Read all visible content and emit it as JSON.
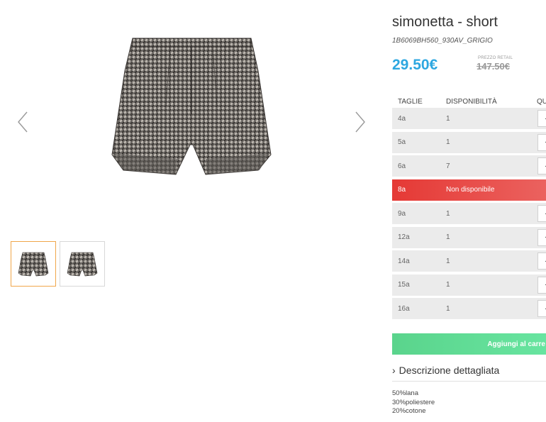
{
  "product": {
    "title": "simonetta - short",
    "sku": "1B6069BH560_930AV_GRIGIO",
    "price": "29.50€",
    "retail_label": "PREZZO RETAIL",
    "retail_price": "147.50€"
  },
  "gallery": {
    "prev_icon": "chevron-left-icon",
    "next_icon": "chevron-right-icon",
    "thumbnail_count": 2,
    "active_thumbnail": 1
  },
  "sizes_table": {
    "headers": [
      "TAGLIE",
      "DISPONIBILITÀ",
      "QU"
    ],
    "rows": [
      {
        "size": "4a",
        "availability": "1",
        "qty": "·"
      },
      {
        "size": "5a",
        "availability": "1",
        "qty": "·"
      },
      {
        "size": "6a",
        "availability": "7",
        "qty": "·"
      },
      {
        "size": "8a",
        "availability": "Non disponibile",
        "qty": ""
      },
      {
        "size": "9a",
        "availability": "1",
        "qty": "·"
      },
      {
        "size": "12a",
        "availability": "1",
        "qty": "·"
      },
      {
        "size": "14a",
        "availability": "1",
        "qty": "·"
      },
      {
        "size": "15a",
        "availability": "1",
        "qty": "·"
      },
      {
        "size": "16a",
        "availability": "1",
        "qty": "·"
      }
    ]
  },
  "cart": {
    "label": "Aggiungi al carre"
  },
  "description": {
    "toggle_label": "Descrizione dettagliata",
    "chevron": "›",
    "composition": [
      "50%lana",
      "30%poliestere",
      "20%cotone"
    ]
  },
  "colors": {
    "price": "#2da7e0",
    "unavailable": "#e53935",
    "cart_button": "#5ad48c",
    "active_thumb_border": "#f0a64a"
  }
}
